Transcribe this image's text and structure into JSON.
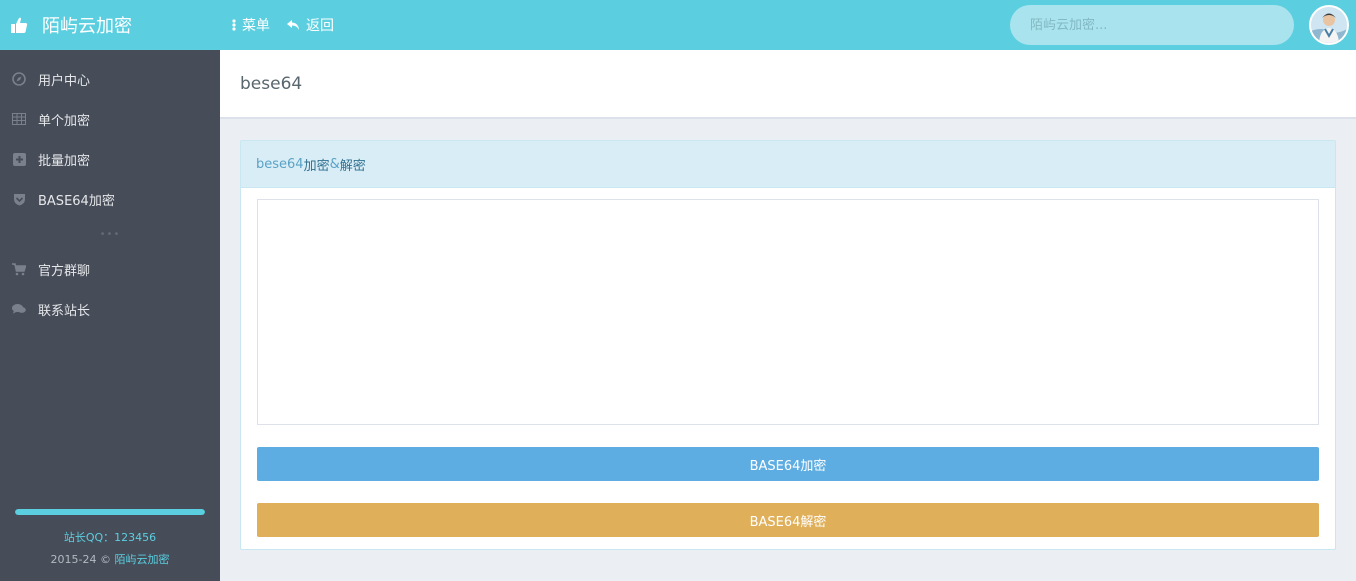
{
  "header": {
    "brand_title": "陌屿云加密",
    "menu_label": "菜单",
    "back_label": "返回",
    "search_placeholder": "陌屿云加密..."
  },
  "sidebar": {
    "items": [
      {
        "label": "用户中心",
        "icon": "compass-icon"
      },
      {
        "label": "单个加密",
        "icon": "table-icon"
      },
      {
        "label": "批量加密",
        "icon": "plus-square-icon"
      },
      {
        "label": "BASE64加密",
        "icon": "shield-icon"
      }
    ],
    "divider": "•••",
    "items2": [
      {
        "label": "官方群聊",
        "icon": "cart-icon"
      },
      {
        "label": "联系站长",
        "icon": "chat-icon"
      }
    ],
    "footer": {
      "progress": 1.0,
      "qq": "站长QQ：123456",
      "copyright_prefix": "2015-24 © ",
      "copyright_link": "陌屿云加密"
    }
  },
  "page": {
    "title": "bese64"
  },
  "panel": {
    "heading_a": "bese64",
    "heading_b": "加密",
    "heading_c": "&",
    "heading_d": "解密",
    "textarea_value": "",
    "encode_label": "BASE64加密",
    "decode_label": "BASE64解密"
  },
  "colors": {
    "header": "#5bcfe0",
    "sidebar": "#464c58",
    "encode_button": "#5dade2",
    "decode_button": "#dfaf5a"
  }
}
